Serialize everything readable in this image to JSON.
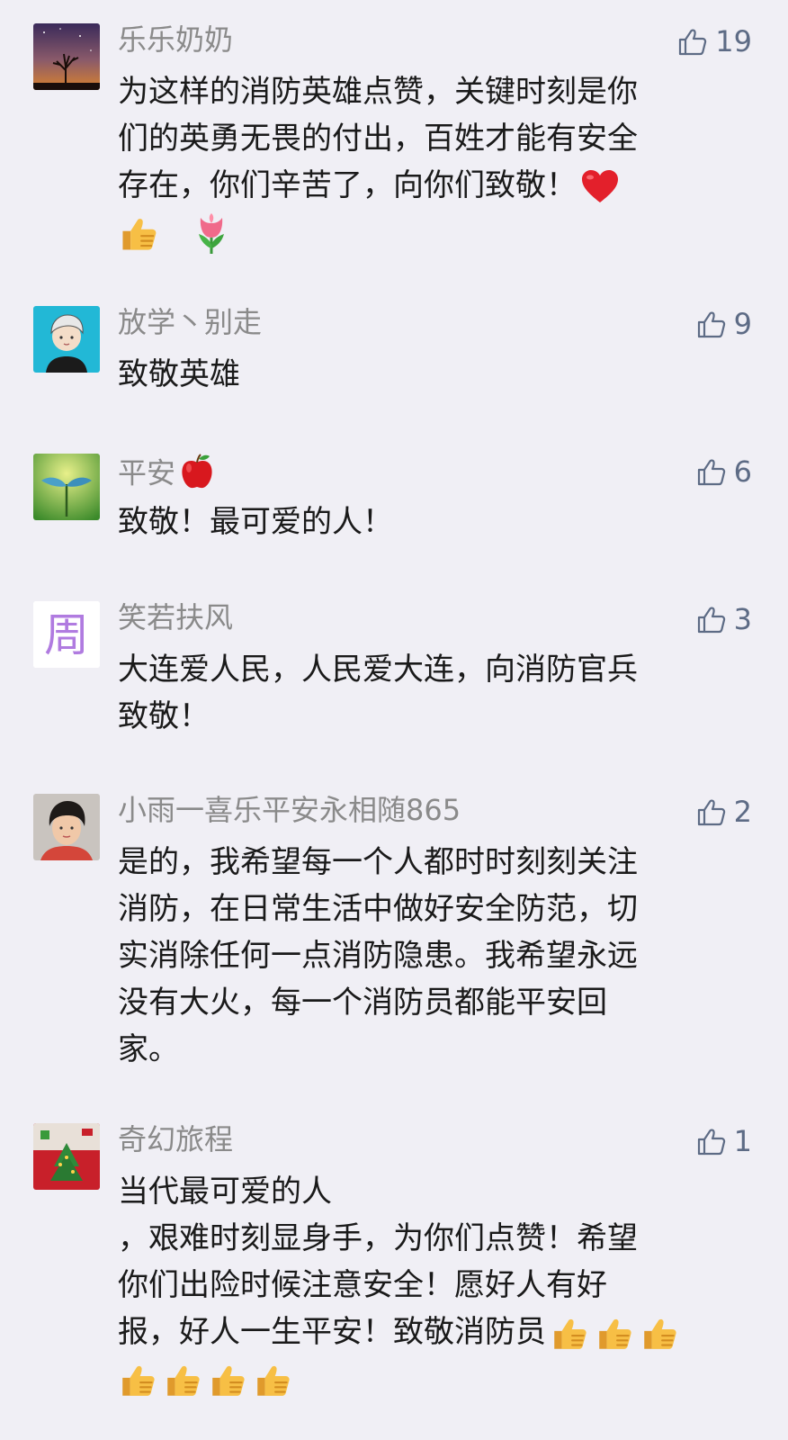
{
  "comments": [
    {
      "nickname": "乐乐奶奶",
      "likes": "19",
      "lines": [
        "为这样的消防英雄点赞，关键时刻是你",
        "们的英勇无畏的付出，百姓才能有安全",
        "存在，你们辛苦了，向你们致敬！"
      ],
      "emojis": [
        "red-heart",
        "thumbs-up",
        "tulip"
      ]
    },
    {
      "nickname": "放学丶别走",
      "likes": "9",
      "lines": [
        "致敬英雄"
      ]
    },
    {
      "nickname": "平安",
      "nickname_emoji": "red-apple",
      "likes": "6",
      "lines": [
        "致敬！最可爱的人！"
      ]
    },
    {
      "nickname": "笑若扶风",
      "avatar_text": "周",
      "likes": "3",
      "lines": [
        "大连爱人民，人民爱大连，向消防官兵",
        "致敬！"
      ]
    },
    {
      "nickname": "小雨一喜乐平安永相随865",
      "likes": "2",
      "lines": [
        "是的，我希望每一个人都时时刻刻关注",
        "消防，在日常生活中做好安全防范，切",
        "实消除任何一点消防隐患。我希望永远",
        "没有大火，每一个消防员都能平安回",
        "家。"
      ]
    },
    {
      "nickname": "奇幻旅程",
      "likes": "1",
      "lines": [
        "当代最可爱的人",
        "，艰难时刻显身手，为你们点赞！希望",
        "你们出险时候注意安全！愿好人有好",
        "报，好人一生平安！致敬消防员"
      ],
      "emojis": [
        "thumbs-up",
        "thumbs-up",
        "thumbs-up",
        "thumbs-up",
        "thumbs-up",
        "thumbs-up",
        "thumbs-up"
      ]
    }
  ],
  "colors": {
    "background": "#f0eff5",
    "nickname": "#8a8a8a",
    "like_icon": "#5d6b85",
    "text": "#1a1a1a"
  }
}
